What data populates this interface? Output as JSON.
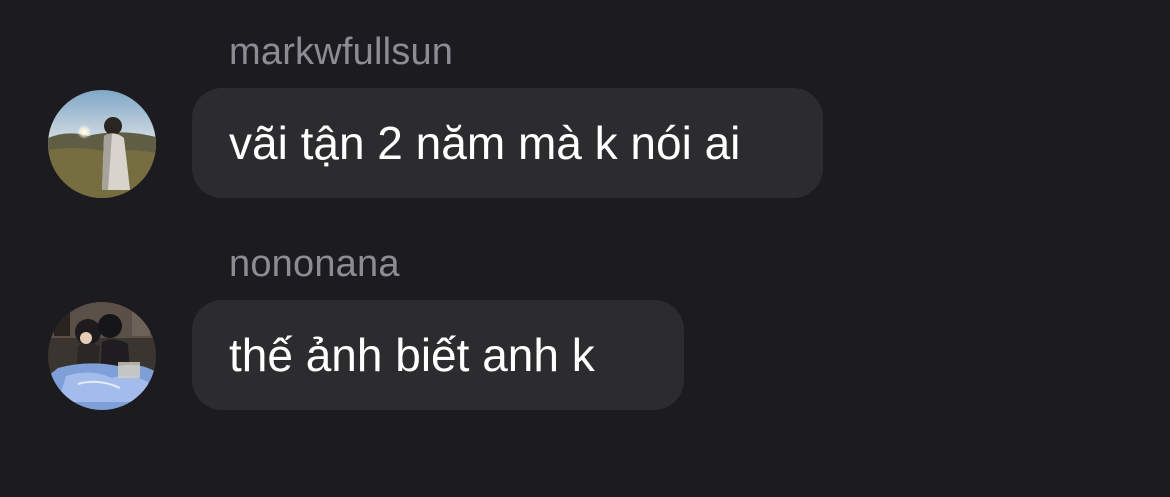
{
  "messages": [
    {
      "sender": "markwfullsun",
      "text": "vãi tận 2 năm mà k nói ai",
      "avatar_icon": "sunset-portrait-avatar"
    },
    {
      "sender": "nononana",
      "text": "thế ảnh biết anh k",
      "avatar_icon": "couple-photo-avatar"
    }
  ],
  "colors": {
    "background": "#1c1b1f",
    "bubble": "#2c2c2e",
    "sender_text": "#8d8c92",
    "message_text": "#ffffff"
  }
}
